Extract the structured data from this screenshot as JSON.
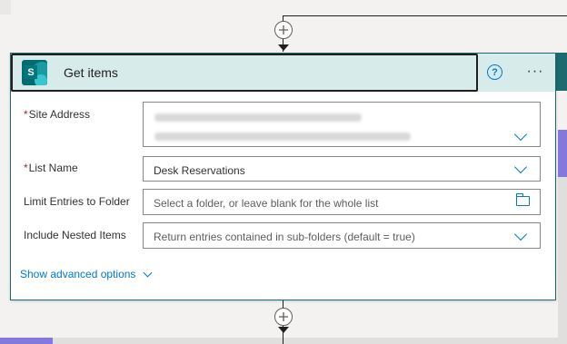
{
  "action": {
    "title": "Get items",
    "icon": "sharepoint-icon",
    "icon_letter": "S",
    "help": "?",
    "more": "···"
  },
  "fields": {
    "site_address": {
      "label": "Site Address",
      "required_mark": "*",
      "value_blurred": true
    },
    "list_name": {
      "label": "List Name",
      "required_mark": "*",
      "value": "Desk Reservations"
    },
    "limit_folder": {
      "label": "Limit Entries to Folder",
      "placeholder": "Select a folder, or leave blank for the whole list"
    },
    "nested_items": {
      "label": "Include Nested Items",
      "placeholder": "Return entries contained in sub-folders (default = true)"
    }
  },
  "advanced": {
    "label": "Show advanced options"
  },
  "colors": {
    "header_bg": "#d7ebea",
    "sharepoint": "#036c70",
    "accent": "#0078d4",
    "required": "#a4262c"
  }
}
